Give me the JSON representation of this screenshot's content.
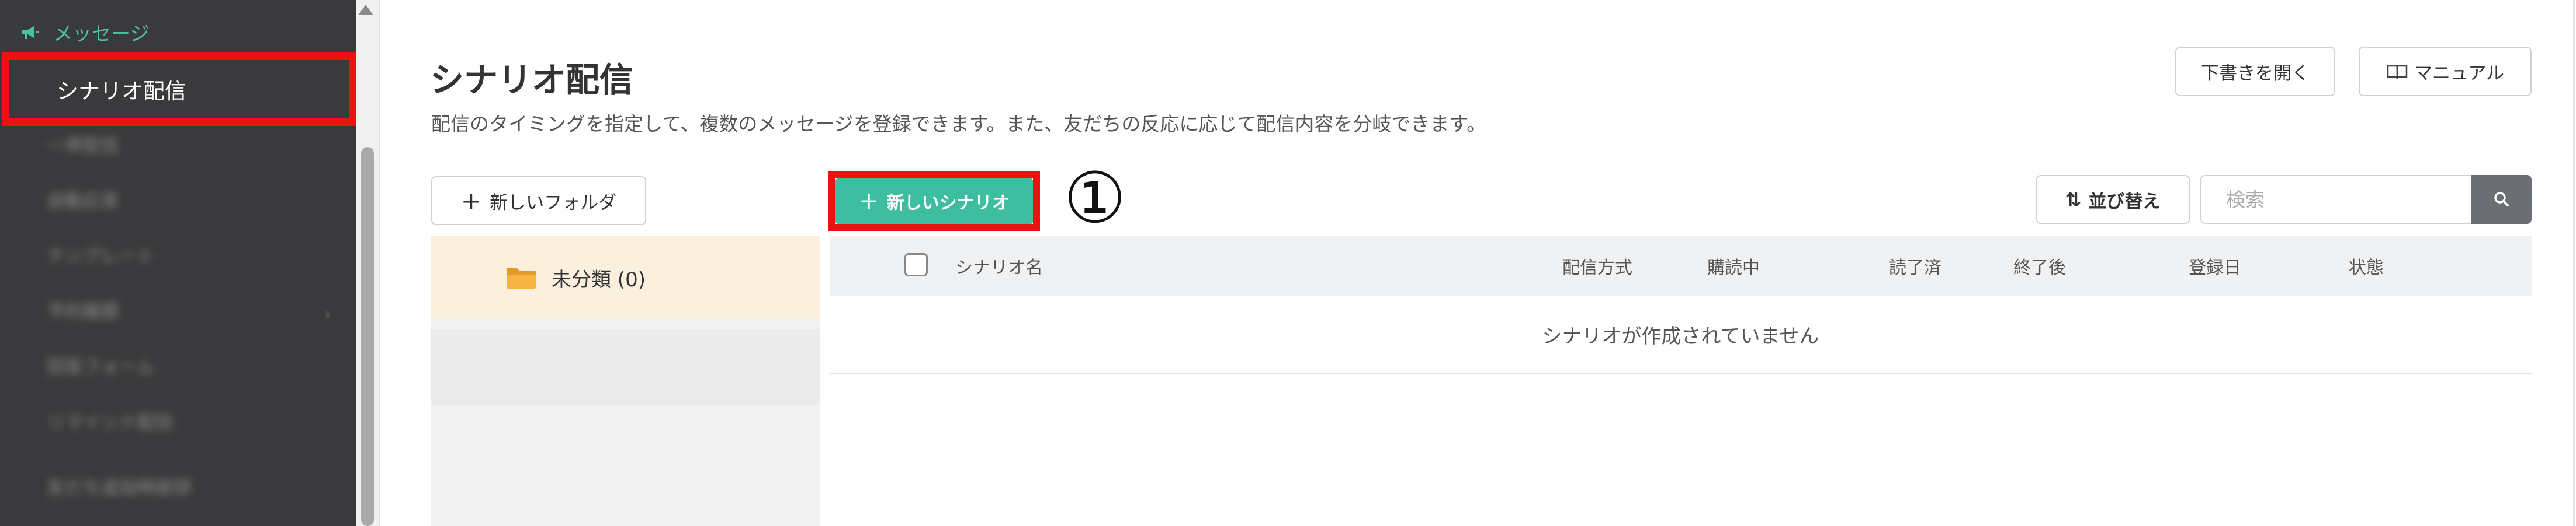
{
  "sidebar": {
    "section_label": "メッセージ",
    "section_icon": "megaphone-icon",
    "active_item": "シナリオ配信",
    "blurred_items": [
      "一斉配信",
      "自動応答",
      "テンプレート",
      "予約履歴",
      "回答フォーム",
      "リマインド配信",
      "友だち追加時挨拶"
    ]
  },
  "page": {
    "title": "シナリオ配信",
    "description": "配信のタイミングを指定して、複数のメッセージを登録できます。また、友だちの反応に応じて配信内容を分岐できます。"
  },
  "header_buttons": {
    "draft": "下書きを開く",
    "manual": "マニュアル"
  },
  "toolbar": {
    "new_folder": "新しいフォルダ",
    "new_scenario": "新しいシナリオ",
    "sort": "並び替え",
    "search_placeholder": "検索"
  },
  "callout": {
    "number": "①"
  },
  "folders": [
    {
      "name": "未分類 (0)"
    }
  ],
  "table": {
    "columns": [
      "シナリオ名",
      "配信方式",
      "購読中",
      "読了済",
      "終了後",
      "登録日",
      "状態"
    ],
    "empty_message": "シナリオが作成されていません"
  },
  "colors": {
    "sidebar_bg": "#3a3a3c",
    "accent_green": "#3ebda0",
    "highlight_red": "#ee1111",
    "folder_selected_bg": "#fbf0de",
    "folder_icon": "#f0a830"
  }
}
